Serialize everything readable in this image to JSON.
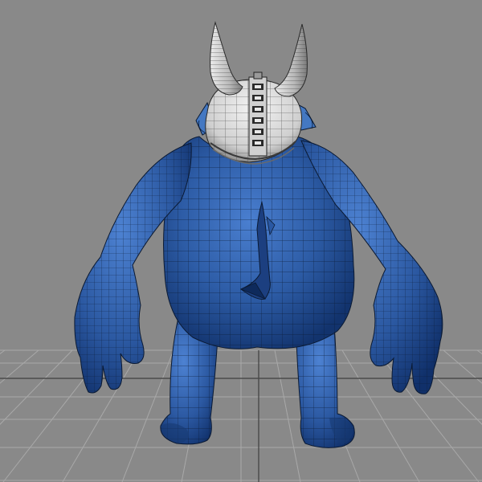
{
  "viewport": {
    "background_color": "#898989",
    "grid_color": "#a9a9a9",
    "grid_axis_color": "#555555",
    "grid_visible": true,
    "display_mode": "shaded-with-wireframe"
  },
  "model": {
    "body_color": "#2f5fa8",
    "body_shadow_color": "#163a78",
    "wire_color": "#0b1a33",
    "helmet_color": "#d9d9d9",
    "helmet_shadow_color": "#8a8a8a",
    "horn_color": "#c8c8c8",
    "strap_color": "#3a6db5"
  }
}
